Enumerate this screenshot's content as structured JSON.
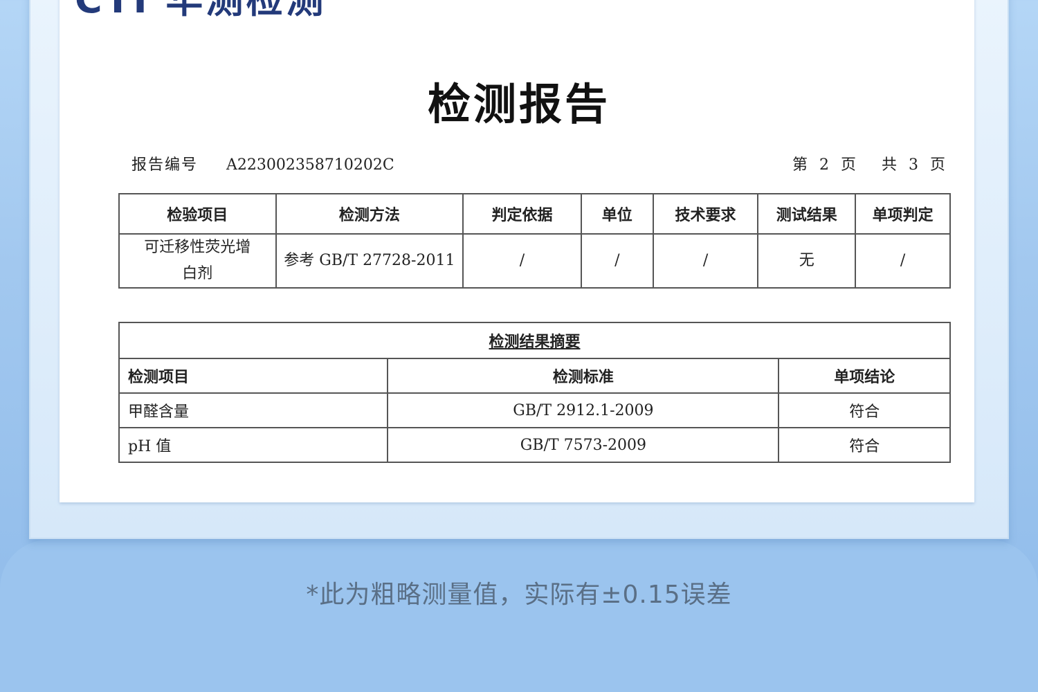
{
  "brand": "CTI 华测检测",
  "title": "检测报告",
  "report_no_label": "报告编号",
  "report_no": "A223002358710202C",
  "page_info": {
    "prefix": "第",
    "current": "2",
    "page_word": "页",
    "total_prefix": "共",
    "total": "3",
    "total_suffix": "页"
  },
  "table1": {
    "headers": [
      "检验项目",
      "检测方法",
      "判定依据",
      "单位",
      "技术要求",
      "测试结果",
      "单项判定"
    ],
    "row": {
      "item_line1": "可迁移性荧光增",
      "item_line2": "白剂",
      "method": "参考 GB/T 27728-2011",
      "basis": "/",
      "unit": "/",
      "requirement": "/",
      "result": "无",
      "verdict": "/"
    }
  },
  "table2": {
    "caption": "检测结果摘要",
    "headers": [
      "检测项目",
      "检测标准",
      "单项结论"
    ],
    "rows": [
      {
        "item": "甲醛含量",
        "standard": "GB/T 2912.1-2009",
        "conclusion": "符合"
      },
      {
        "item": "pH 值",
        "standard": "GB/T 7573-2009",
        "conclusion": "符合"
      }
    ]
  },
  "note": "*此为粗略测量值，实际有±0.15误差"
}
